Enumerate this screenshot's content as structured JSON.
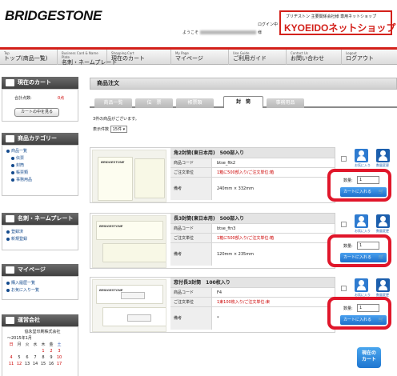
{
  "header": {
    "logo": "BRIDGESTONE",
    "login_link": "ログイン中",
    "greeting_prefix": "ようこそ",
    "greeting_suffix": "様",
    "banner_small": "ブリヂストン 主要関係会社様 専用ネットショップ",
    "banner_large": "KYOEIDOネットショップ"
  },
  "nav": [
    {
      "en": "Top",
      "jp": "トップ(商品一覧)"
    },
    {
      "en": "Business Card & Name Plate",
      "jp": "名刺・ネームプレート"
    },
    {
      "en": "Shopping Cart",
      "jp": "現在のカート"
    },
    {
      "en": "My Page",
      "jp": "マイページ"
    },
    {
      "en": "Use Guide",
      "jp": "ご利用ガイド"
    },
    {
      "en": "Contact Us",
      "jp": "お問い合わせ"
    },
    {
      "en": "Logout",
      "jp": "ログアウト"
    }
  ],
  "sidebar": {
    "cart": {
      "title": "現在のカート",
      "total_label": "合計点数:",
      "total_value": "0点",
      "button": "カートの中を見る"
    },
    "category": {
      "title": "商品カテゴリー",
      "items": [
        {
          "label": "商品一覧",
          "sub": false
        },
        {
          "label": "伝票",
          "sub": true
        },
        {
          "label": "封筒",
          "sub": true
        },
        {
          "label": "帳票類",
          "sub": true
        },
        {
          "label": "事務用品",
          "sub": true
        }
      ]
    },
    "namecard": {
      "title": "名刺・ネームプレート",
      "items": [
        "登録済",
        "新規登録"
      ]
    },
    "mypage": {
      "title": "マイページ",
      "items": [
        "購入履歴一覧",
        "お気に入り一覧"
      ]
    },
    "company": {
      "title": "運営会社",
      "name": "協永堂印刷株式会社",
      "month": "～2015年1月"
    },
    "calendar": {
      "weekdays": [
        "日",
        "月",
        "火",
        "水",
        "木",
        "金",
        "土"
      ],
      "rows": [
        [
          "",
          "",
          "",
          "",
          "1",
          "2",
          "3"
        ],
        [
          "4",
          "5",
          "6",
          "7",
          "8",
          "9",
          "10"
        ],
        [
          "11",
          "12",
          "13",
          "14",
          "15",
          "16",
          "17"
        ]
      ]
    }
  },
  "main": {
    "title": "商品注文",
    "tabs": [
      "商品一覧",
      "伝　票",
      "帳票類",
      "封　筒",
      "事務用品"
    ],
    "active_tab": 3,
    "info": "3件の商品がございます。",
    "display_label": "表示件数",
    "display_value": "15件",
    "quantity_label": "数量:",
    "quantity_value": "1",
    "cart_button": "カートに入れる",
    "fav_label": "お気に入り",
    "bulk_label": "数量変更",
    "products": [
      {
        "name": "角2封筒(東日本用)　500部入り",
        "code_label": "商品コード",
        "code": "btse_ftk2",
        "unit_label": "ご注文単位",
        "unit": "1箱に500部入り/ご注文単位:箱",
        "note_label": "備考",
        "note": "240mm × 332mm"
      },
      {
        "name": "長3封筒(東日本用)　500部入り",
        "code_label": "商品コード",
        "code": "btse_ftn3",
        "unit_label": "ご注文単位",
        "unit": "1箱に500部入り/ご注文単位:箱",
        "note_label": "備考",
        "note": "120mm × 235mm"
      },
      {
        "name": "窓付長3封筒　100枚入り",
        "code_label": "商品コード",
        "code": "F4",
        "unit_label": "ご注文単位",
        "unit": "1束100枚入り/ご注文単位:束",
        "note_label": "備考",
        "note": "*"
      }
    ],
    "float_cart": [
      "現在の",
      "カート"
    ]
  },
  "colors": {
    "accent": "#d3201a",
    "link": "#134a8d",
    "button": "#1c6fca"
  }
}
